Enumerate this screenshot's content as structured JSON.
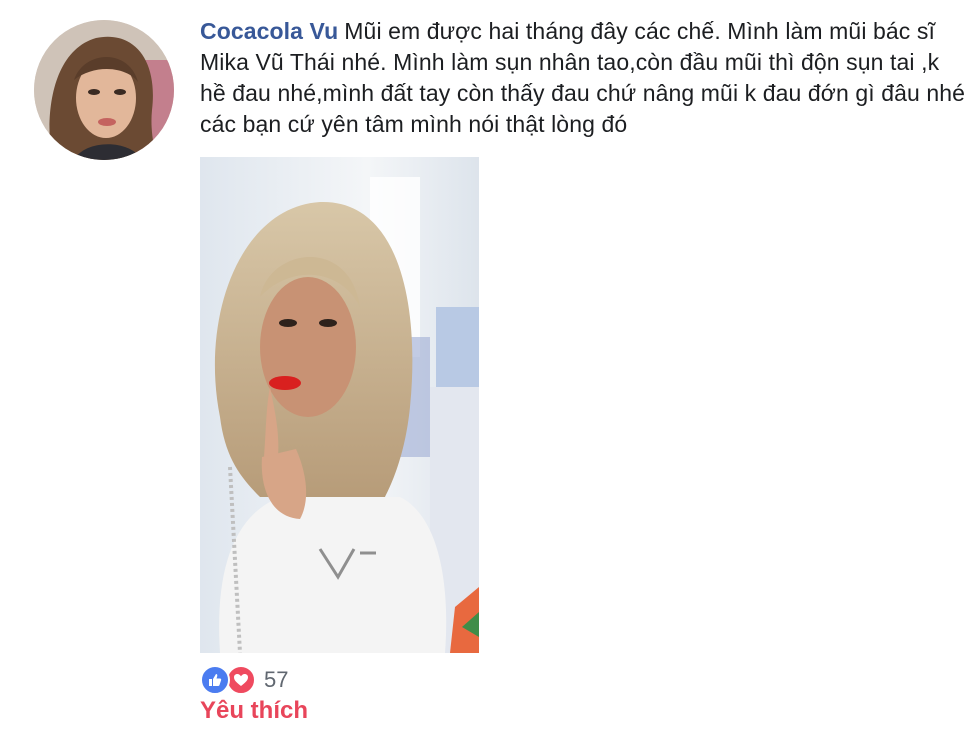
{
  "comment": {
    "author": "Cocacola Vu",
    "text": "Mũi em được hai tháng đây các chế. Mình làm mũi bác sĩ Mika Vũ Thái nhé. Mình làm sụn nhân tao,còn đầu mũi thì độn sụn tai ,k hề đau nhé,mình đất tay còn thấy đau chứ nâng mũi k đau đớn gì đâu nhé các bạn cứ yên tâm mình nói thật lòng đó"
  },
  "reactions": {
    "icons": [
      "like-icon",
      "love-icon"
    ],
    "count": "57",
    "like_color": "#4b7cf0",
    "love_color": "#ef4a5f"
  },
  "actions": {
    "like_label": "Yêu thích",
    "like_color": "#e8455a"
  },
  "colors": {
    "author_name": "#385898",
    "body_text": "#1c1e21"
  }
}
